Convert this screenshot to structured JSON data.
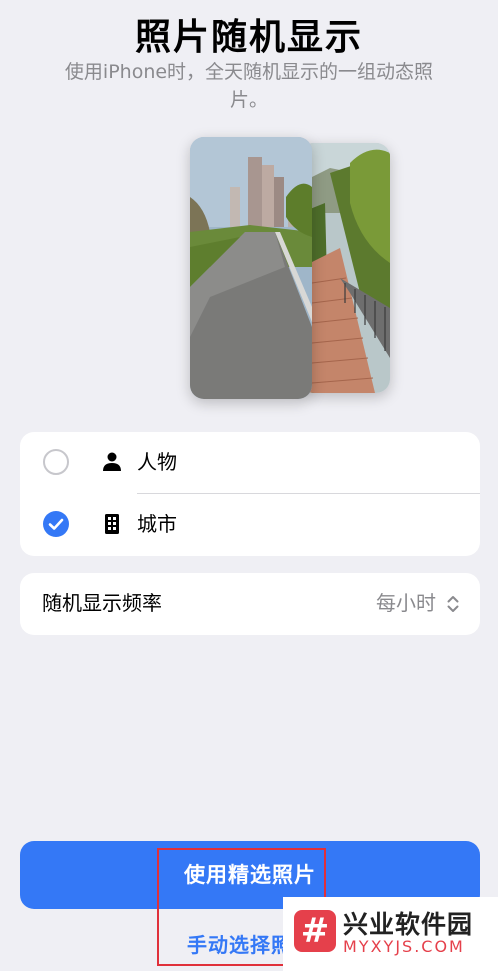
{
  "header": {
    "title": "照片随机显示",
    "subtitle": "使用iPhone时，全天随机显示的一组动态照片。"
  },
  "preview": {
    "front_photo": "city-walkway-photo",
    "back_photo": "stairway-photo"
  },
  "options": [
    {
      "label": "人物",
      "icon": "person-icon",
      "checked": false
    },
    {
      "label": "城市",
      "icon": "building-icon",
      "checked": true
    }
  ],
  "frequency": {
    "label": "随机显示频率",
    "value": "每小时"
  },
  "actions": {
    "primary_label": "使用精选照片",
    "secondary_label": "手动选择照片"
  },
  "watermark": {
    "logo_glyph": "#",
    "name": "兴业软件园",
    "url": "MYXYJS.COM"
  },
  "colors": {
    "accent": "#3478f6",
    "background": "#efeff4",
    "card": "#ffffff",
    "secondary_text": "#8a8a8e",
    "highlight": "#e0303a",
    "watermark_brand": "#e5404b"
  }
}
